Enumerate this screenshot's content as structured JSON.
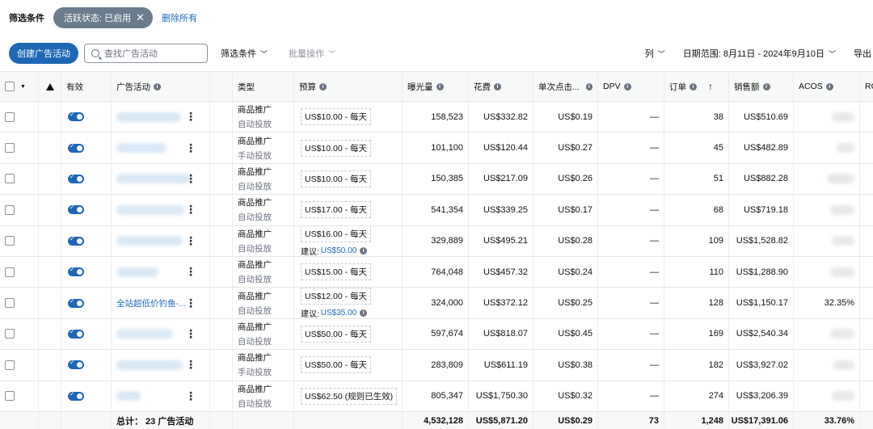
{
  "filter_bar": {
    "title": "筛选条件",
    "chip_label": "活跃状态: 已启用",
    "chip_close": "✕",
    "clear_all": "删除所有"
  },
  "toolbar": {
    "create_button": "创建广告活动",
    "search_placeholder": "查找广告活动",
    "filter": "筛选条件",
    "bulk": "批量操作",
    "columns": "列",
    "date_range": "日期范围: 8月11日 - 2024年9月10日",
    "export": "导出"
  },
  "columns": {
    "active": "有效",
    "campaign": "广告活动",
    "type": "类型",
    "budget": "预算",
    "impressions": "曝光量",
    "spend": "花费",
    "cpc": "单次点击...",
    "dpv": "DPV",
    "orders": "订单",
    "sales": "销售额",
    "acos": "ACOS",
    "roas": "RO"
  },
  "rows": [
    {
      "campaign": "",
      "type": "商品推广",
      "targeting": "自动投放",
      "budget": "US$10.00 - 每天",
      "suggest_label": "",
      "suggest_value": "",
      "impressions": "158,523",
      "spend": "US$332.82",
      "cpc": "US$0.19",
      "dpv": "—",
      "orders": "38",
      "sales": "US$510.69",
      "acos": ""
    },
    {
      "campaign": "",
      "type": "商品推广",
      "targeting": "手动投放",
      "budget": "US$10.00 - 每天",
      "suggest_label": "",
      "suggest_value": "",
      "impressions": "101,100",
      "spend": "US$120.44",
      "cpc": "US$0.27",
      "dpv": "—",
      "orders": "45",
      "sales": "US$482.89",
      "acos": ""
    },
    {
      "campaign": "",
      "type": "商品推广",
      "targeting": "自动投放",
      "budget": "US$10.00 - 每天",
      "suggest_label": "",
      "suggest_value": "",
      "impressions": "150,385",
      "spend": "US$217.09",
      "cpc": "US$0.26",
      "dpv": "—",
      "orders": "51",
      "sales": "US$882.28",
      "acos": ""
    },
    {
      "campaign": "",
      "type": "商品推广",
      "targeting": "自动投放",
      "budget": "US$17.00 - 每天",
      "suggest_label": "",
      "suggest_value": "",
      "impressions": "541,354",
      "spend": "US$339.25",
      "cpc": "US$0.17",
      "dpv": "—",
      "orders": "68",
      "sales": "US$719.18",
      "acos": ""
    },
    {
      "campaign": "",
      "type": "商品推广",
      "targeting": "自动投放",
      "budget": "US$16.00 - 每天",
      "suggest_label": "建议:",
      "suggest_value": "US$50.00",
      "impressions": "329,889",
      "spend": "US$495.21",
      "cpc": "US$0.28",
      "dpv": "—",
      "orders": "109",
      "sales": "US$1,528.82",
      "acos": ""
    },
    {
      "campaign": "",
      "type": "商品推广",
      "targeting": "自动投放",
      "budget": "US$15.00 - 每天",
      "suggest_label": "",
      "suggest_value": "",
      "impressions": "764,048",
      "spend": "US$457.32",
      "cpc": "US$0.24",
      "dpv": "—",
      "orders": "110",
      "sales": "US$1,288.90",
      "acos": ""
    },
    {
      "campaign": "全站超低价钓鱼-...",
      "type": "商品推广",
      "targeting": "自动投放",
      "budget": "US$12.00 - 每天",
      "suggest_label": "建议:",
      "suggest_value": "US$35.00",
      "impressions": "324,000",
      "spend": "US$372.12",
      "cpc": "US$0.25",
      "dpv": "—",
      "orders": "128",
      "sales": "US$1,150.17",
      "acos": "32.35%"
    },
    {
      "campaign": "",
      "type": "商品推广",
      "targeting": "自动投放",
      "budget": "US$50.00 - 每天",
      "suggest_label": "",
      "suggest_value": "",
      "impressions": "597,674",
      "spend": "US$818.07",
      "cpc": "US$0.45",
      "dpv": "—",
      "orders": "169",
      "sales": "US$2,540.34",
      "acos": ""
    },
    {
      "campaign": "",
      "type": "商品推广",
      "targeting": "手动投放",
      "budget": "US$50.00 - 每天",
      "suggest_label": "",
      "suggest_value": "",
      "impressions": "283,809",
      "spend": "US$611.19",
      "cpc": "US$0.38",
      "dpv": "—",
      "orders": "182",
      "sales": "US$3,927.02",
      "acos": ""
    },
    {
      "campaign": "",
      "type": "商品推广",
      "targeting": "自动投放",
      "budget": "US$62.50 (规则已生效)",
      "suggest_label": "",
      "suggest_value": "",
      "impressions": "805,347",
      "spend": "US$1,750.30",
      "cpc": "US$0.32",
      "dpv": "—",
      "orders": "274",
      "sales": "US$3,206.39",
      "acos": ""
    }
  ],
  "totals": {
    "label": "总计： 23 广告活动",
    "impressions": "4,532,128",
    "spend": "US$5,871.20",
    "cpc": "US$0.29",
    "dpv": "73",
    "orders": "1,248",
    "sales": "US$17,391.06",
    "acos": "33.76%"
  }
}
